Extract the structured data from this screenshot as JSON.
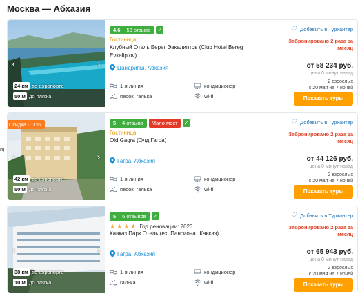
{
  "route_title": "Москва — Абхазия",
  "colors": {
    "accent": "#ffa000",
    "rating": "#3fae3f",
    "booked": "#e2462a",
    "link": "#1a6fb5",
    "location": "#1a8fd8",
    "discount": "#ff7a1a"
  },
  "common": {
    "fav_label": "Добавить в Турхантер",
    "button_label": "Показать туры",
    "price_updated": "цена 0 минут назад",
    "dist_airport_label": "до аэропорта",
    "dist_beach_label": "до пляжа"
  },
  "hotels": [
    {
      "rating": "4.6",
      "reviews": "53 отзыва",
      "badge": "",
      "category": "Гостиница",
      "name": "Клубный Отель Берег Эвкалиптов (Club Hotel Bereg Evkaliptov)",
      "location": "Цандрипш, Абхазия",
      "dist_airport": "24 км",
      "dist_beach": "50 м",
      "features": [
        "1-я линия",
        "кондиционер",
        "песок, галька",
        "wi-fi"
      ],
      "booked": "Забронировано 2 раза за месяц",
      "price": "от 58 234 руб.",
      "pax_line1": "2 взрослых",
      "pax_line2": "с 20 мая на 7 ночей"
    },
    {
      "rating": "5",
      "reviews": "4 отзыва",
      "badge": "Мало мест",
      "discount": "Скидка - 11%",
      "side_fragment": "я)",
      "category": "Гостиница",
      "name": "Old Gagra (Олд Гагра)",
      "location": "Гагра, Абхазия",
      "dist_airport": "42 км",
      "dist_beach": "50 м",
      "features": [
        "1-я линия",
        "кондиционер",
        "песок, галька",
        "wi-fi"
      ],
      "booked": "Забронировано 2 раза за месяц",
      "price": "от 44 126 руб.",
      "pax_line1": "2 взрослых",
      "pax_line2": "с 20 мая на 7 ночей"
    },
    {
      "rating": "5",
      "reviews": "6 отзывов",
      "badge": "",
      "stars": 4,
      "renovation": "Год реновации: 2023",
      "name": "Кавказ Парк Отель (ex. Пансионат Кавказ)",
      "location": "Гагра, Абхазия",
      "dist_airport": "38 км",
      "dist_beach": "10 м",
      "features": [
        "1-я линия",
        "кондиционер",
        "галька",
        "wi-fi"
      ],
      "booked": "Забронировано 2 раза за месяц",
      "price": "от 65 943 руб.",
      "pax_line1": "2 взрослых",
      "pax_line2": "с 20 мая на 7 ночей"
    }
  ]
}
